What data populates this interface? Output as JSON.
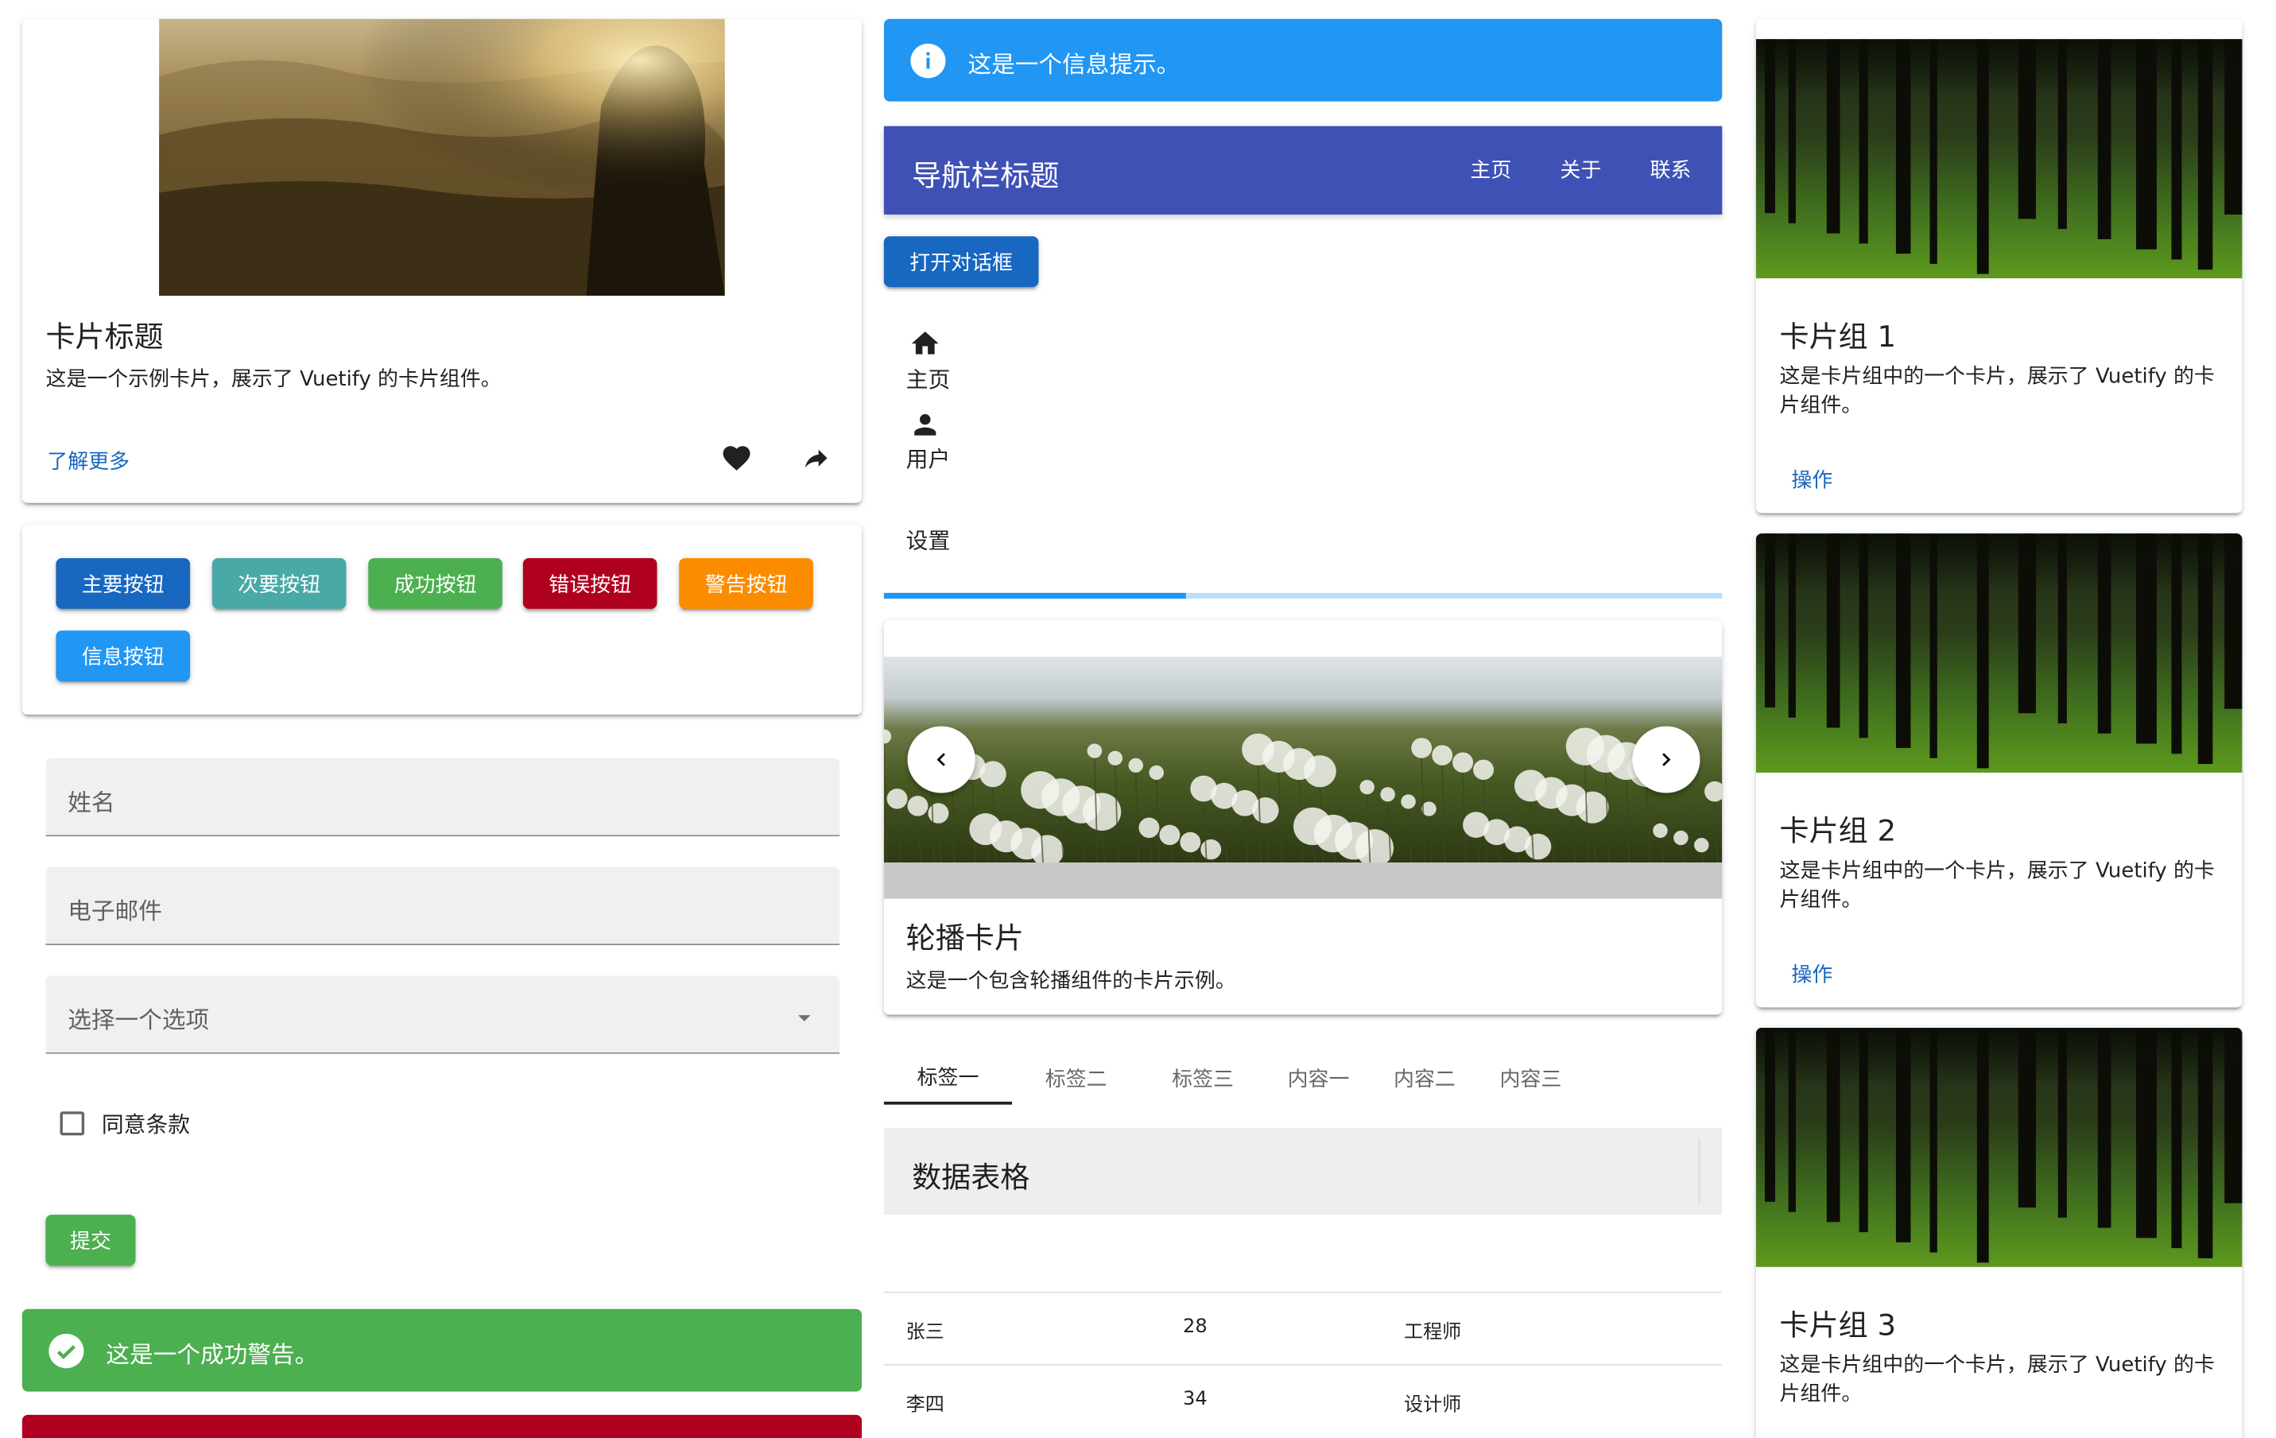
{
  "example_card": {
    "title": "卡片标题",
    "text": "这是一个示例卡片，展示了 Vuetify 的卡片组件。",
    "action_label": "了解更多",
    "icons": [
      "heart-icon",
      "share-icon"
    ]
  },
  "buttons": {
    "primary": "主要按钮",
    "secondary": "次要按钮",
    "success": "成功按钮",
    "error": "错误按钮",
    "warning": "警告按钮",
    "info": "信息按钮"
  },
  "form": {
    "name_label": "姓名",
    "email_label": "电子邮件",
    "select_label": "选择一个选项",
    "checkbox_label": "同意条款",
    "submit_label": "提交"
  },
  "alerts": {
    "success_text": "这是一个成功警告。",
    "info_text": "这是一个信息提示。"
  },
  "navbar": {
    "title": "导航栏标题",
    "links": [
      "主页",
      "关于",
      "联系"
    ]
  },
  "dialog_button": "打开对话框",
  "bottom_nav": {
    "items": [
      "主页",
      "用户",
      "设置"
    ]
  },
  "progress": {
    "value": 0.36
  },
  "carousel_card": {
    "title": "轮播卡片",
    "text": "这是一个包含轮播组件的卡片示例。"
  },
  "tabs": [
    "标签一",
    "标签二",
    "标签三",
    "内容一",
    "内容二",
    "内容三"
  ],
  "data_table": {
    "title": "数据表格",
    "rows": [
      [
        "张三",
        "28",
        "工程师"
      ],
      [
        "李四",
        "34",
        "设计师"
      ]
    ]
  },
  "card_group": [
    {
      "title": "卡片组 1",
      "text": "这是卡片组中的一个卡片，展示了 Vuetify 的卡片组件。",
      "action": "操作"
    },
    {
      "title": "卡片组 2",
      "text": "这是卡片组中的一个卡片，展示了 Vuetify 的卡片组件。",
      "action": "操作"
    },
    {
      "title": "卡片组 3",
      "text": "这是卡片组中的一个卡片，展示了 Vuetify 的卡片组件。"
    }
  ],
  "colors": {
    "primary": "#1867c0",
    "secondary": "#48a9a6",
    "success": "#4caf50",
    "error": "#b00020",
    "warning": "#fb8c00",
    "info": "#2196f3",
    "navbar": "#3f51b5"
  }
}
